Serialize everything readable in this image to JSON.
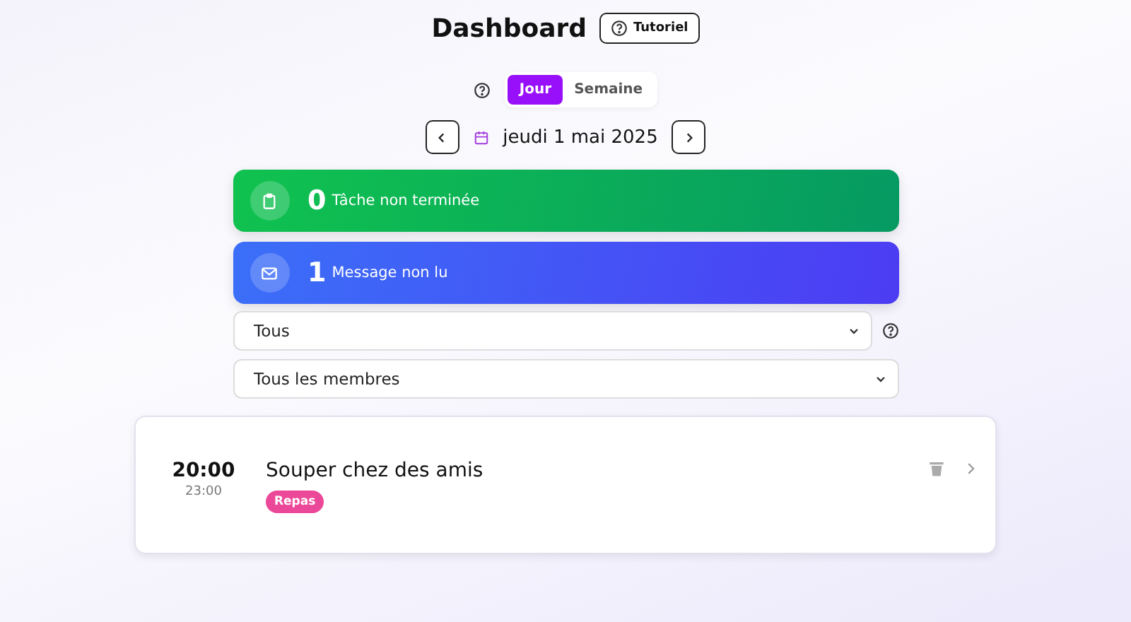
{
  "header": {
    "title": "Dashboard",
    "tutorial_button": "Tutoriel"
  },
  "view_toggle": [
    {
      "label": "Jour",
      "selected": true
    },
    {
      "label": "Semaine",
      "selected": false
    }
  ],
  "date": "jeudi 1 mai 2025",
  "stats": [
    {
      "kind": "tasks",
      "count": "0",
      "label": "Tâche non terminée"
    },
    {
      "kind": "messages",
      "count": "1",
      "label": "Message non lu"
    }
  ],
  "filters": [
    {
      "value": "Tous",
      "help": true
    },
    {
      "value": "Tous les membres",
      "help": false
    }
  ],
  "events": [
    {
      "start": "20:00",
      "end": "23:00",
      "title": "Souper chez des amis",
      "tag": {
        "label": "Repas",
        "color": "#ec4899"
      }
    }
  ]
}
